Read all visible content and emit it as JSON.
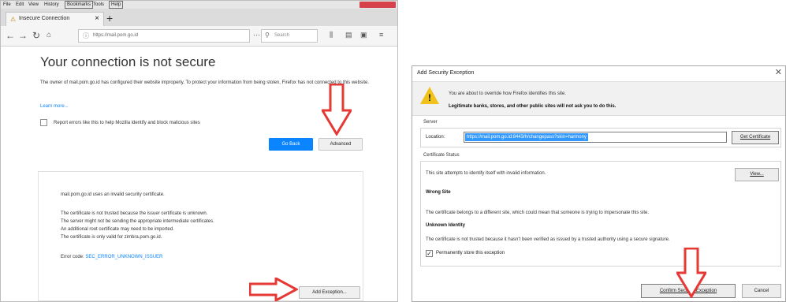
{
  "browser": {
    "menu": [
      "File",
      "Edit",
      "View",
      "History",
      "Bookmarks",
      "Tools",
      "Help"
    ],
    "tab_title": "Insecure Connection",
    "url": "https://mail.pom.go.id",
    "search_placeholder": "Search"
  },
  "error_page": {
    "title": "Your connection is not secure",
    "description": "The owner of mail.pom.go.id has configured their website improperly. To protect your information from being stolen, Firefox has not connected to this website.",
    "learn_more": "Learn more...",
    "report_label": "Report errors like this to help Mozilla identify and block malicious sites",
    "go_back_label": "Go Back",
    "advanced_label": "Advanced",
    "advanced_panel": {
      "invalid_cert": "mail.pom.go.id uses an invalid security certificate.",
      "lines": [
        "The certificate is not trusted because the issuer certificate is unknown.",
        "The server might not be sending the appropriate intermediate certificates.",
        "An additional root certificate may need to be imported.",
        "The certificate is only valid for zimbra.pom.go.id."
      ],
      "error_code_label": "Error code:",
      "error_code": "SEC_ERROR_UNKNOWN_ISSUER",
      "add_exception_label": "Add Exception..."
    }
  },
  "dialog": {
    "title": "Add Security Exception",
    "warning_line1": "You are about to override how Firefox identifies this site.",
    "warning_line2": "Legitimate banks, stores, and other public sites will not ask you to do this.",
    "server_label": "Server",
    "location_label": "Location:",
    "location_value": "https://mail.pom.go.id:8443/h/changepass?skin=harmony",
    "get_certificate_label": "Get Certificate",
    "status_label": "Certificate Status",
    "status_intro": "This site attempts to identify itself with invalid information.",
    "view_label": "View...",
    "wrong_site_heading": "Wrong Site",
    "wrong_site_text": "The certificate belongs to a different site, which could mean that someone is trying to impersonate this site.",
    "unknown_identity_heading": "Unknown Identity",
    "unknown_identity_text": "The certificate is not trusted because it hasn't been verified as issued by a trusted authority using a secure signature.",
    "permanent_label": "Permanently store this exception",
    "confirm_label": "Confirm Security Exception",
    "cancel_label": "Cancel"
  },
  "colors": {
    "annotation_arrow": "#e53935",
    "go_back_blue": "#0a84ff",
    "location_selection": "#3399ff",
    "warning_yellow": "#f1c21b"
  }
}
